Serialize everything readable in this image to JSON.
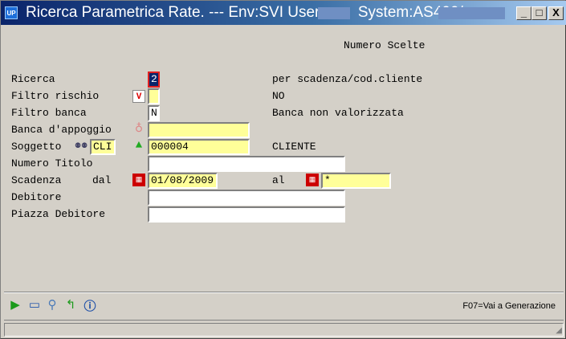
{
  "window": {
    "app_icon": "UP",
    "title": "Ricerca Parametrica Rate. --- Env:SVI User:        System:AS400/",
    "minimize": "_",
    "maximize": "□",
    "close": "X"
  },
  "header": "Numero Scelte",
  "fields": {
    "ricerca": {
      "label": "Ricerca",
      "value": "2",
      "desc": "per scadenza/cod.cliente"
    },
    "filtro_rischio": {
      "label": "Filtro rischio",
      "value": "",
      "desc": "NO"
    },
    "filtro_banca": {
      "label": "Filtro banca",
      "value": "N",
      "desc": "Banca non valorizzata"
    },
    "banca_appoggio": {
      "label": "Banca d'appoggio",
      "value": ""
    },
    "soggetto": {
      "label": "Soggetto",
      "type": "CLI",
      "value": "000004",
      "desc": "CLIENTE"
    },
    "numero_titolo": {
      "label": "Numero Titolo",
      "value": ""
    },
    "scadenza": {
      "label": "Scadenza",
      "dal_label": "dal",
      "dal": "01/08/2009",
      "al_label": "al",
      "al": "*"
    },
    "debitore": {
      "label": "Debitore",
      "value": ""
    },
    "piazza_debitore": {
      "label": "Piazza Debitore",
      "value": ""
    }
  },
  "footer": {
    "hint": "F07=Vai a Generazione"
  }
}
